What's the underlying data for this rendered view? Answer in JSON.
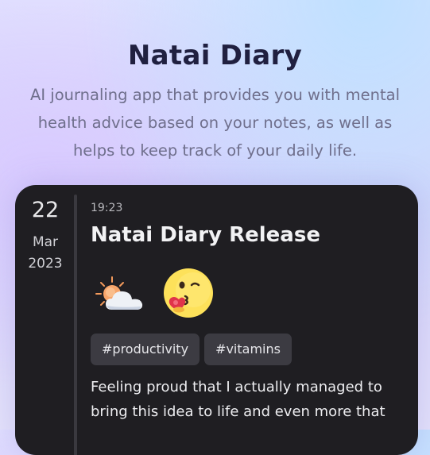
{
  "hero": {
    "title": "Natai Diary",
    "subtitle": "AI journaling app that provides you with mental health advice based on your notes, as well as helps to keep track of your daily life."
  },
  "entry": {
    "date": {
      "day": "22",
      "month": "Mar",
      "year": "2023"
    },
    "time": "19:23",
    "title": "Natai Diary Release",
    "emojis": [
      "sun-behind-cloud-icon",
      "kissing-face-with-heart-icon"
    ],
    "tags": [
      "#productivity",
      "#vitamins"
    ],
    "body": "Feeling proud that I actually managed to bring this idea to life and even more that"
  },
  "colors": {
    "card_bg": "#1f1e22",
    "tag_bg": "#3c3b42",
    "title_dark": "#202040",
    "subtitle": "#6f6f8c"
  }
}
